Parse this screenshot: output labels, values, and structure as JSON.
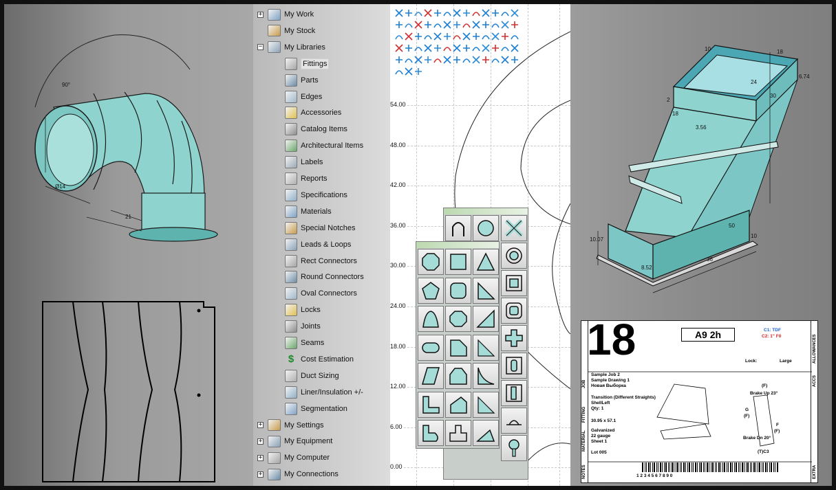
{
  "tree": {
    "items": [
      {
        "label": "My Work",
        "level": 1,
        "expander": "+",
        "icon": "monitor-icon"
      },
      {
        "label": "My Stock",
        "level": 1,
        "expander": "",
        "icon": "stock-folder-icon"
      },
      {
        "label": "My Libraries",
        "level": 1,
        "expander": "−",
        "icon": "books-icon"
      },
      {
        "label": "Fittings",
        "level": 2,
        "icon": "fitting-icon",
        "selected": true
      },
      {
        "label": "Parts",
        "level": 2,
        "icon": "parts-icon"
      },
      {
        "label": "Edges",
        "level": 2,
        "icon": "edges-icon"
      },
      {
        "label": "Accessories",
        "level": 2,
        "icon": "accessories-icon"
      },
      {
        "label": "Catalog Items",
        "level": 2,
        "icon": "catalog-icon"
      },
      {
        "label": "Architectural Items",
        "level": 2,
        "icon": "architectural-icon"
      },
      {
        "label": "Labels",
        "level": 2,
        "icon": "label-icon"
      },
      {
        "label": "Reports",
        "level": 2,
        "icon": "reports-icon"
      },
      {
        "label": "Specifications",
        "level": 2,
        "icon": "specifications-icon"
      },
      {
        "label": "Materials",
        "level": 2,
        "icon": "materials-icon"
      },
      {
        "label": "Special Notches",
        "level": 2,
        "icon": "notches-icon"
      },
      {
        "label": "Leads & Loops",
        "level": 2,
        "icon": "leads-loops-icon"
      },
      {
        "label": "Rect Connectors",
        "level": 2,
        "icon": "rect-connector-icon"
      },
      {
        "label": "Round Connectors",
        "level": 2,
        "icon": "round-connector-icon"
      },
      {
        "label": "Oval Connectors",
        "level": 2,
        "icon": "oval-connector-icon"
      },
      {
        "label": "Locks",
        "level": 2,
        "icon": "lock-icon"
      },
      {
        "label": "Joints",
        "level": 2,
        "icon": "joint-icon"
      },
      {
        "label": "Seams",
        "level": 2,
        "icon": "seam-icon"
      },
      {
        "label": "Cost Estimation",
        "level": 2,
        "icon": "dollar-icon"
      },
      {
        "label": "Duct Sizing",
        "level": 2,
        "icon": "duct-sizing-icon"
      },
      {
        "label": "Liner/Insulation +/-",
        "level": 2,
        "icon": "liner-icon"
      },
      {
        "label": "Segmentation",
        "level": 2,
        "icon": "segmentation-icon"
      },
      {
        "label": "My Settings",
        "level": 1,
        "expander": "+",
        "icon": "settings-icon"
      },
      {
        "label": "My Equipment",
        "level": 1,
        "expander": "+",
        "icon": "equipment-icon"
      },
      {
        "label": "My Computer",
        "level": 1,
        "expander": "+",
        "icon": "computer-icon"
      },
      {
        "label": "My Connections",
        "level": 1,
        "expander": "+",
        "icon": "connections-icon"
      }
    ]
  },
  "cad": {
    "y_ticks": [
      "54.00",
      "48.00",
      "42.00",
      "36.00",
      "30.00",
      "24.00",
      "18.00",
      "12.00",
      "6.00",
      "0.00"
    ]
  },
  "elbow": {
    "angle": "90°",
    "diameter": "Ø14",
    "depth": "21"
  },
  "transition": {
    "dims": [
      "10",
      "18",
      "6.74",
      "24",
      "2",
      "30",
      "18",
      "3.56",
      "50",
      "10.07",
      "8.52",
      "36",
      "10"
    ]
  },
  "label_card": {
    "number": "18",
    "code": "A9  2h",
    "c1": "C1: TDF",
    "c2": "C2: 1\" F0",
    "lock_label": "Lock:",
    "lock_value": "Large",
    "sections": {
      "job": "JOB",
      "fitting": "FITTING",
      "material": "MATERIAL",
      "notes": "NOTES",
      "allowances": "ALLOWANCES",
      "accs": "ACCS",
      "extra": "EXTRA"
    },
    "job_lines": [
      "Sample Job 2",
      "Sample Drawing 1",
      "Новая Выборка"
    ],
    "fitting_lines": [
      "Transition (Different Straights)",
      "ShellLeft",
      "Qty: 1"
    ],
    "size": "30.95 x 57.1",
    "material_lines": [
      "Galvanized",
      "22 gauge",
      "Sheet 1"
    ],
    "lot": "Lot 005",
    "brake_up": "Brake Up 23°",
    "brake_dn": "Brake Dn 20°",
    "seam_a": "(F)",
    "seam_g": "G",
    "seam_gf": "(F)",
    "seam_f": "F",
    "seam_ff": "(F)",
    "seam_tc": "(T)C3",
    "barcode_digits": "1  2  3  4  5  6  7  8  9  0"
  },
  "colors": {
    "duct": "#8fd3cf",
    "duct_dark": "#5fb3ae",
    "palette_bg": "#c8ceca"
  }
}
